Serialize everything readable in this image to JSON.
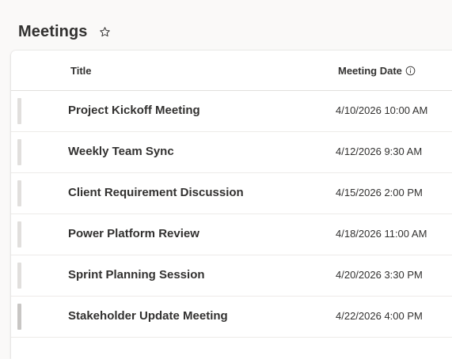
{
  "page": {
    "title": "Meetings",
    "favorite_icon": "star-outline-icon"
  },
  "list": {
    "columns": {
      "title": "Title",
      "meeting_date": "Meeting Date",
      "meeting_date_info_icon": "info-icon"
    },
    "rows": [
      {
        "title": "Project Kickoff Meeting",
        "meeting_date": "4/10/2026 10:00 AM"
      },
      {
        "title": "Weekly Team Sync",
        "meeting_date": "4/12/2026 9:30 AM"
      },
      {
        "title": "Client Requirement Discussion",
        "meeting_date": "4/15/2026 2:00 PM"
      },
      {
        "title": "Power Platform Review",
        "meeting_date": "4/18/2026 11:00 AM"
      },
      {
        "title": "Sprint Planning Session",
        "meeting_date": "4/20/2026 3:30 PM"
      },
      {
        "title": "Stakeholder Update Meeting",
        "meeting_date": "4/22/2026 4:00 PM"
      }
    ]
  },
  "colors": {
    "background": "#faf9f8",
    "card": "#ffffff",
    "text": "#323130",
    "divider": "#edebe9",
    "row_handle": "#e1dfdd"
  }
}
